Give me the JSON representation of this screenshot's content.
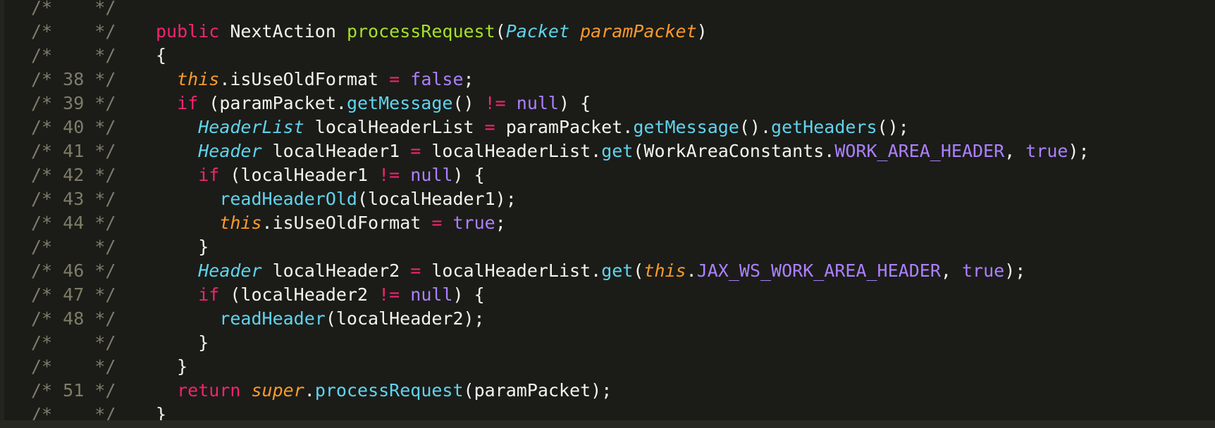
{
  "lines": [
    {
      "comment": "/*    */",
      "tokens": []
    },
    {
      "comment": "/*    */",
      "tokens": [
        {
          "t": "public",
          "c": "kw"
        },
        {
          "t": " NextAction ",
          "c": "pl"
        },
        {
          "t": "processRequest",
          "c": "fn"
        },
        {
          "t": "(",
          "c": "pl"
        },
        {
          "t": "Packet",
          "c": "ty"
        },
        {
          "t": " ",
          "c": "pl"
        },
        {
          "t": "paramPacket",
          "c": "pa"
        },
        {
          "t": ")",
          "c": "pl"
        }
      ]
    },
    {
      "comment": "/*    */",
      "tokens": [
        {
          "t": "{",
          "c": "pl"
        }
      ]
    },
    {
      "comment": "/* 38 */",
      "tokens": [
        {
          "t": "  ",
          "c": "pl"
        },
        {
          "t": "this",
          "c": "th"
        },
        {
          "t": ".isUseOldFormat ",
          "c": "pl"
        },
        {
          "t": "=",
          "c": "kw"
        },
        {
          "t": " ",
          "c": "pl"
        },
        {
          "t": "false",
          "c": "cn"
        },
        {
          "t": ";",
          "c": "pl"
        }
      ]
    },
    {
      "comment": "/* 39 */",
      "tokens": [
        {
          "t": "  ",
          "c": "pl"
        },
        {
          "t": "if",
          "c": "kw"
        },
        {
          "t": " (paramPacket.",
          "c": "pl"
        },
        {
          "t": "getMessage",
          "c": "ca"
        },
        {
          "t": "() ",
          "c": "pl"
        },
        {
          "t": "!=",
          "c": "kw"
        },
        {
          "t": " ",
          "c": "pl"
        },
        {
          "t": "null",
          "c": "cn"
        },
        {
          "t": ") {",
          "c": "pl"
        }
      ]
    },
    {
      "comment": "/* 40 */",
      "tokens": [
        {
          "t": "    ",
          "c": "pl"
        },
        {
          "t": "HeaderList",
          "c": "ty"
        },
        {
          "t": " localHeaderList ",
          "c": "pl"
        },
        {
          "t": "=",
          "c": "kw"
        },
        {
          "t": " paramPacket.",
          "c": "pl"
        },
        {
          "t": "getMessage",
          "c": "ca"
        },
        {
          "t": "().",
          "c": "pl"
        },
        {
          "t": "getHeaders",
          "c": "ca"
        },
        {
          "t": "();",
          "c": "pl"
        }
      ]
    },
    {
      "comment": "/* 41 */",
      "tokens": [
        {
          "t": "    ",
          "c": "pl"
        },
        {
          "t": "Header",
          "c": "ty"
        },
        {
          "t": " localHeader1 ",
          "c": "pl"
        },
        {
          "t": "=",
          "c": "kw"
        },
        {
          "t": " localHeaderList.",
          "c": "pl"
        },
        {
          "t": "get",
          "c": "ca"
        },
        {
          "t": "(WorkAreaConstants.",
          "c": "pl"
        },
        {
          "t": "WORK_AREA_HEADER",
          "c": "cn"
        },
        {
          "t": ", ",
          "c": "pl"
        },
        {
          "t": "true",
          "c": "cn"
        },
        {
          "t": ");",
          "c": "pl"
        }
      ]
    },
    {
      "comment": "/* 42 */",
      "tokens": [
        {
          "t": "    ",
          "c": "pl"
        },
        {
          "t": "if",
          "c": "kw"
        },
        {
          "t": " (localHeader1 ",
          "c": "pl"
        },
        {
          "t": "!=",
          "c": "kw"
        },
        {
          "t": " ",
          "c": "pl"
        },
        {
          "t": "null",
          "c": "cn"
        },
        {
          "t": ") {",
          "c": "pl"
        }
      ]
    },
    {
      "comment": "/* 43 */",
      "tokens": [
        {
          "t": "      ",
          "c": "pl"
        },
        {
          "t": "readHeaderOld",
          "c": "ca"
        },
        {
          "t": "(localHeader1);",
          "c": "pl"
        }
      ]
    },
    {
      "comment": "/* 44 */",
      "tokens": [
        {
          "t": "      ",
          "c": "pl"
        },
        {
          "t": "this",
          "c": "th"
        },
        {
          "t": ".isUseOldFormat ",
          "c": "pl"
        },
        {
          "t": "=",
          "c": "kw"
        },
        {
          "t": " ",
          "c": "pl"
        },
        {
          "t": "true",
          "c": "cn"
        },
        {
          "t": ";",
          "c": "pl"
        }
      ]
    },
    {
      "comment": "/*    */",
      "tokens": [
        {
          "t": "    }",
          "c": "pl"
        }
      ]
    },
    {
      "comment": "/* 46 */",
      "tokens": [
        {
          "t": "    ",
          "c": "pl"
        },
        {
          "t": "Header",
          "c": "ty"
        },
        {
          "t": " localHeader2 ",
          "c": "pl"
        },
        {
          "t": "=",
          "c": "kw"
        },
        {
          "t": " localHeaderList.",
          "c": "pl"
        },
        {
          "t": "get",
          "c": "ca"
        },
        {
          "t": "(",
          "c": "pl"
        },
        {
          "t": "this",
          "c": "th"
        },
        {
          "t": ".",
          "c": "pl"
        },
        {
          "t": "JAX_WS_WORK_AREA_HEADER",
          "c": "cn"
        },
        {
          "t": ", ",
          "c": "pl"
        },
        {
          "t": "true",
          "c": "cn"
        },
        {
          "t": ");",
          "c": "pl"
        }
      ]
    },
    {
      "comment": "/* 47 */",
      "tokens": [
        {
          "t": "    ",
          "c": "pl"
        },
        {
          "t": "if",
          "c": "kw"
        },
        {
          "t": " (localHeader2 ",
          "c": "pl"
        },
        {
          "t": "!=",
          "c": "kw"
        },
        {
          "t": " ",
          "c": "pl"
        },
        {
          "t": "null",
          "c": "cn"
        },
        {
          "t": ") {",
          "c": "pl"
        }
      ]
    },
    {
      "comment": "/* 48 */",
      "tokens": [
        {
          "t": "      ",
          "c": "pl"
        },
        {
          "t": "readHeader",
          "c": "ca"
        },
        {
          "t": "(localHeader2);",
          "c": "pl"
        }
      ]
    },
    {
      "comment": "/*    */",
      "tokens": [
        {
          "t": "    }",
          "c": "pl"
        }
      ]
    },
    {
      "comment": "/*    */",
      "tokens": [
        {
          "t": "  }",
          "c": "pl"
        }
      ]
    },
    {
      "comment": "/* 51 */",
      "tokens": [
        {
          "t": "  ",
          "c": "pl"
        },
        {
          "t": "return",
          "c": "kw"
        },
        {
          "t": " ",
          "c": "pl"
        },
        {
          "t": "super",
          "c": "th"
        },
        {
          "t": ".",
          "c": "pl"
        },
        {
          "t": "processRequest",
          "c": "ca"
        },
        {
          "t": "(paramPacket);",
          "c": "pl"
        }
      ]
    },
    {
      "comment": "/*    */",
      "tokens": [
        {
          "t": "}",
          "c": "pl"
        }
      ]
    }
  ]
}
